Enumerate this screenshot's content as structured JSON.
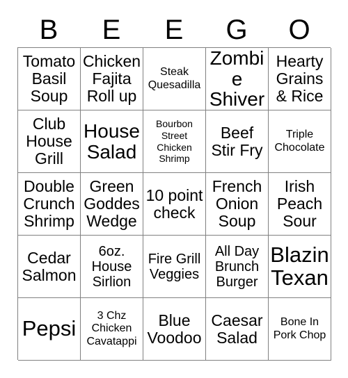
{
  "card": {
    "title_letters": [
      "B",
      "E",
      "E",
      "G",
      "O"
    ],
    "columns": 5,
    "rows": 5,
    "border_color": "#808080",
    "text_color": "#000000",
    "background_color": "#ffffff",
    "cells": [
      [
        {
          "text": "Tomato Basil Soup",
          "size": "lg"
        },
        {
          "text": "Chicken Fajita Roll up",
          "size": "lg"
        },
        {
          "text": "Steak Quesadilla",
          "size": "sm"
        },
        {
          "text": "Zombie Shiver",
          "size": "xl"
        },
        {
          "text": "Hearty Grains & Rice",
          "size": "lg"
        }
      ],
      [
        {
          "text": "Club House Grill",
          "size": "lg"
        },
        {
          "text": "House Salad",
          "size": "xl"
        },
        {
          "text": "Bourbon Street Chicken Shrimp",
          "size": "xs"
        },
        {
          "text": "Beef Stir Fry",
          "size": "lg"
        },
        {
          "text": "Triple Chocolate",
          "size": "sm"
        }
      ],
      [
        {
          "text": "Double Crunch Shrimp",
          "size": "lg"
        },
        {
          "text": "Green Goddes Wedge",
          "size": "lg"
        },
        {
          "text": "10 point check",
          "size": "lg"
        },
        {
          "text": "French Onion Soup",
          "size": "lg"
        },
        {
          "text": "Irish Peach Sour",
          "size": "lg"
        }
      ],
      [
        {
          "text": "Cedar Salmon",
          "size": "lg"
        },
        {
          "text": "6oz. House Sirlion",
          "size": "md"
        },
        {
          "text": "Fire Grill Veggies",
          "size": "md"
        },
        {
          "text": "All Day Brunch Burger",
          "size": "md"
        },
        {
          "text": "Blazin Texan",
          "size": "xxl"
        }
      ],
      [
        {
          "text": "Pepsi",
          "size": "xxl"
        },
        {
          "text": "3 Chz Chicken Cavatappi",
          "size": "sm"
        },
        {
          "text": "Blue Voodoo",
          "size": "lg"
        },
        {
          "text": "Caesar Salad",
          "size": "lg"
        },
        {
          "text": "Bone In Pork Chop",
          "size": "sm"
        }
      ]
    ]
  }
}
